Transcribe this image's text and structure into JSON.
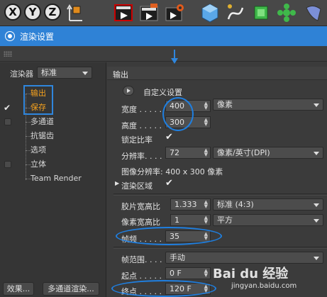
{
  "toolbar": {
    "axes": [
      "X",
      "Y",
      "Z"
    ]
  },
  "window": {
    "title": "渲染设置"
  },
  "left_panel": {
    "renderer_label": "渲染器",
    "renderer_value": "标准",
    "items": [
      {
        "label": "输出",
        "checked": false,
        "highlighted": true
      },
      {
        "label": "保存",
        "checked": true,
        "highlighted": true
      },
      {
        "label": "多通道",
        "checked": false,
        "highlighted": false
      },
      {
        "label": "抗锯齿",
        "checked": false,
        "highlighted": false
      },
      {
        "label": "选项",
        "checked": false,
        "highlighted": false
      },
      {
        "label": "立体",
        "checked": false,
        "highlighted": false
      },
      {
        "label": "Team Render",
        "checked": false,
        "highlighted": false
      }
    ],
    "effects_button": "效果...",
    "multipass_button": "多通道渲染..."
  },
  "output": {
    "section_title": "输出",
    "preset_label": "自定义设置",
    "width_label": "宽度 . . . . .",
    "width_value": "400",
    "height_label": "高度 . . . . .",
    "height_value": "300",
    "unit_value": "像素",
    "lock_ratio_label": "锁定比率",
    "resolution_label": "分辨率. . . . .",
    "resolution_value": "72",
    "resolution_unit": "像素/英寸(DPI)",
    "image_resolution": "图像分辨率: 400 x 300 像素",
    "render_region_label": "渲染区域",
    "film_aspect_label": "胶片宽高比",
    "film_aspect_value": "1.333",
    "film_aspect_preset": "标准 (4:3)",
    "pixel_aspect_label": "像素宽高比",
    "pixel_aspect_value": "1",
    "pixel_aspect_preset": "平方",
    "fps_label": "帧频 . . . . .",
    "fps_value": "35",
    "frame_range_label": "帧范围. . . .",
    "frame_range_value": "手动",
    "start_label": "起点 . . . . .",
    "start_value": "0 F",
    "end_label": "终点 . . . . .",
    "end_value": "120 F"
  },
  "watermark": {
    "brand": "Bai du 经验",
    "url": "jingyan.baidu.com"
  },
  "colors": {
    "title_bar": "#2f82d6",
    "highlight_orange": "#f6a21e",
    "annotation_blue": "#1f7fe0"
  }
}
